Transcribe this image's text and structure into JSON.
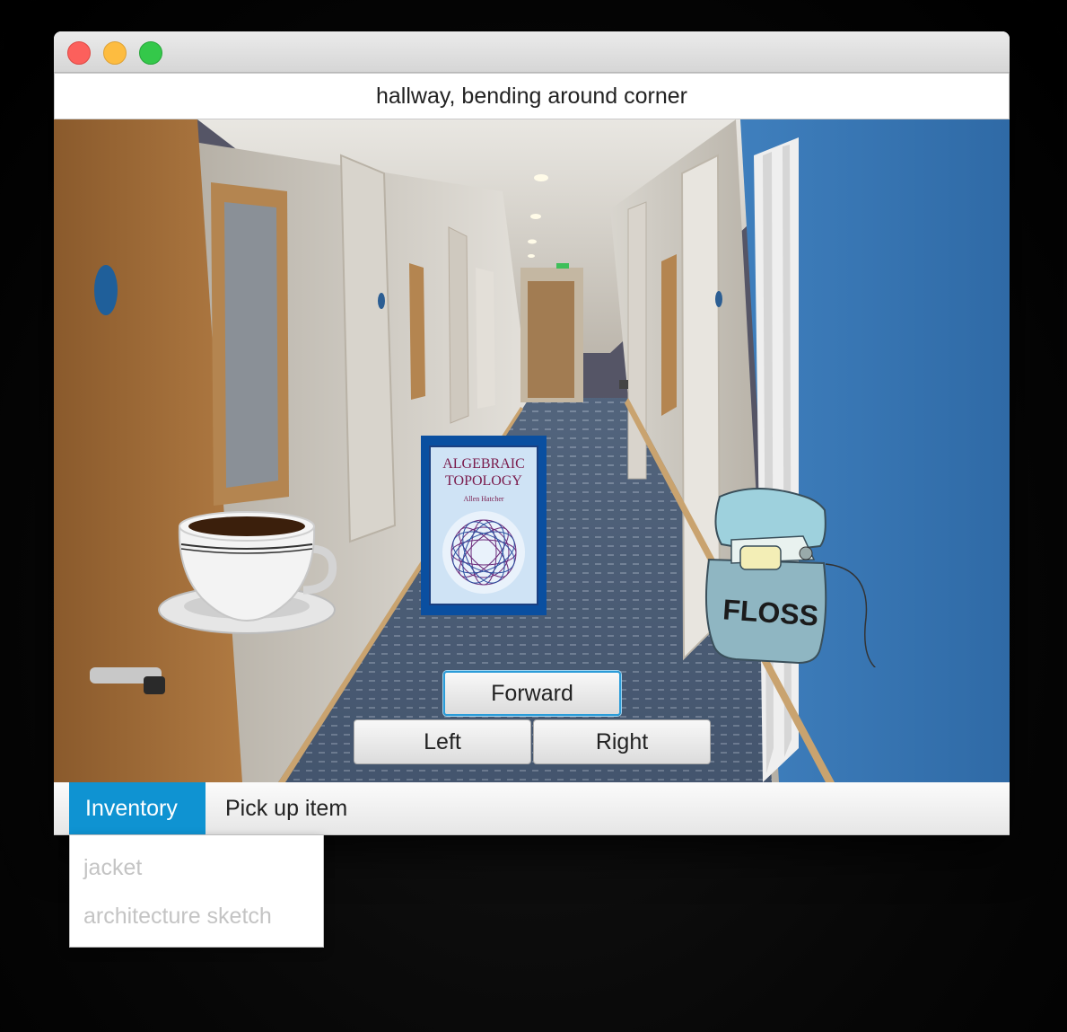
{
  "window": {
    "location_title": "hallway, bending around corner"
  },
  "scene": {
    "items": [
      {
        "name": "coffee cup",
        "icon": "coffee-cup-icon"
      },
      {
        "name": "Algebraic Topology book",
        "icon": "book-icon",
        "cover_title_line1": "ALGEBRAIC",
        "cover_title_line2": "TOPOLOGY",
        "cover_author": "Allen Hatcher"
      },
      {
        "name": "floss",
        "icon": "floss-icon",
        "label": "FLOSS"
      }
    ]
  },
  "navigation": {
    "forward": "Forward",
    "left": "Left",
    "right": "Right"
  },
  "menubar": {
    "inventory": "Inventory",
    "pickup": "Pick up item"
  },
  "inventory_menu": {
    "items": [
      "jacket",
      "architecture sketch"
    ]
  },
  "colors": {
    "menu_highlight": "#0f93d2",
    "focus_ring": "#2b9cd8",
    "book_blue": "#0a4fa0",
    "wall_blue": "#3a78b4"
  }
}
